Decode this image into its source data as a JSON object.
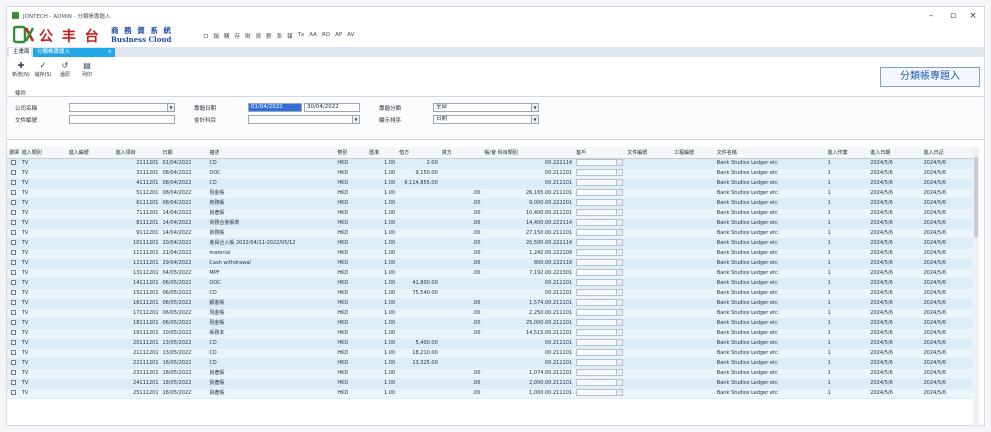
{
  "window": {
    "title": "JONTECH - ADMIN - 分類帳專題入",
    "controls": {
      "minimize": "–",
      "maximize": "▫",
      "close": "×"
    }
  },
  "brand": {
    "cn": "公 丰 台",
    "cn2": "商 務 資 系 統",
    "en": "Business Cloud"
  },
  "menu": [
    "ロ",
    "銷",
    "購",
    "存",
    "財",
    "資",
    "薪",
    "系",
    "報",
    "Tx",
    "AA",
    "RO",
    "AP",
    "AV"
  ],
  "tabs": [
    {
      "label": "主畫面"
    },
    {
      "label": "分類帳專題入",
      "close": "×"
    }
  ],
  "toolbar": {
    "buttons": [
      {
        "icon": "✚",
        "label": "新增(N)"
      },
      {
        "icon": "✓",
        "label": "儲存(S)"
      },
      {
        "icon": "↺",
        "label": "還原"
      },
      {
        "icon": "▤",
        "label": "列印"
      }
    ],
    "heading": "分類帳專題入",
    "condition_label": "條件"
  },
  "filters": {
    "company_code": {
      "label": "公司名稱",
      "value": ""
    },
    "doc_no": {
      "label": "文件編號",
      "value": ""
    },
    "date": {
      "label": "專題日期",
      "from": "01/04/2022",
      "to": "30/04/2022"
    },
    "account": {
      "label": "會計科目",
      "value": ""
    },
    "type": {
      "label": "專題分類",
      "value": "全部"
    },
    "sort": {
      "label": "顯示排序",
      "value": "日期"
    }
  },
  "table": {
    "columns": [
      "選擇",
      "進入類別",
      "進入編號",
      "進入項目",
      "日期",
      "描述",
      "幣別",
      "匯率",
      "借方",
      "貸方",
      "帳/會 科目類別",
      "客戶",
      "文件編號",
      "工程編號",
      "文件名稱",
      "進入作業",
      "進入日期",
      "進入日記"
    ],
    "rows": [
      [
        "TV",
        "",
        "2111201",
        "01/04/2022",
        "CD",
        "HKD",
        "1.00",
        "2.00",
        "",
        "00.222114",
        "",
        "",
        "",
        "Bank Studios Ledger etc",
        "1",
        "2024/5/6",
        "2024/5/6"
      ],
      [
        "TV",
        "",
        "3111201",
        "08/04/2022",
        "OOC",
        "HKD",
        "1.00",
        "9,150.00",
        "",
        "00.211101",
        "",
        "",
        "",
        "Bank Studios Ledger etc",
        "1",
        "2024/5/6",
        "2024/5/6"
      ],
      [
        "TV",
        "",
        "4111201",
        "08/04/2022",
        "CD",
        "HKD",
        "1.00",
        "6,114,855.00",
        "",
        "00.211101",
        "",
        "",
        "",
        "Bank Studios Ledger etc",
        "1",
        "2024/5/6",
        "2024/5/6"
      ],
      [
        "TV",
        "",
        "5111201",
        "08/04/2022",
        "現金帳",
        "HKD",
        "1.00",
        "",
        ".00",
        "26,165.00.211101",
        "",
        "",
        "",
        "Bank Studios Ledger etc",
        "1",
        "2024/5/6",
        "2024/5/6"
      ],
      [
        "TV",
        "",
        "6111201",
        "08/04/2022",
        "商務帳",
        "HKD",
        "1.00",
        "",
        ".00",
        "9,000.00.222201",
        "",
        "",
        "",
        "Bank Studios Ledger etc",
        "1",
        "2024/5/6",
        "2024/5/6"
      ],
      [
        "TV",
        "",
        "7111201",
        "14/04/2022",
        "資產帳",
        "HKD",
        "1.00",
        "",
        ".00",
        "10,400.00.211101",
        "",
        "",
        "",
        "Bank Studios Ledger etc",
        "1",
        "2024/5/6",
        "2024/5/6"
      ],
      [
        "TV",
        "",
        "8111201",
        "14/04/2022",
        "商務合會帳表",
        "HKD",
        "1.00",
        "",
        ".00",
        "14,400.00.222114",
        "",
        "",
        "",
        "Bank Studios Ledger etc",
        "1",
        "2024/5/6",
        "2024/5/6"
      ],
      [
        "TV",
        "",
        "9111201",
        "14/04/2022",
        "商務帳",
        "HKD",
        "1.00",
        "",
        ".00",
        "27,150.00.211101",
        "",
        "",
        "",
        "Bank Studios Ledger etc",
        "1",
        "2024/5/6",
        "2024/5/6"
      ],
      [
        "TV",
        "",
        "10111201",
        "20/04/2022",
        "會員合入帳 2022/04/11-2022/05/12",
        "HKD",
        "1.00",
        "",
        ".00",
        "20,500.00.222114",
        "",
        "",
        "",
        "Bank Studios Ledger etc",
        "1",
        "2024/5/6",
        "2024/5/6"
      ],
      [
        "TV",
        "",
        "11111201",
        "21/04/2022",
        "material",
        "HKD",
        "1.00",
        "",
        ".00",
        "1,242.00.222109",
        "",
        "",
        "",
        "Bank Studios Ledger etc",
        "1",
        "2024/5/6",
        "2024/5/6"
      ],
      [
        "TV",
        "",
        "12111201",
        "29/04/2022",
        "Cash withdrawal",
        "HKD",
        "1.00",
        "",
        ".00",
        "800.00.222118",
        "",
        "",
        "",
        "Bank Studios Ledger etc",
        "1",
        "2024/5/6",
        "2024/5/6"
      ],
      [
        "TV",
        "",
        "13111201",
        "04/05/2022",
        "MPF",
        "HKD",
        "1.00",
        "",
        ".00",
        "7,192.00.221301",
        "",
        "",
        "",
        "Bank Studios Ledger etc",
        "1",
        "2024/5/6",
        "2024/5/6"
      ],
      [
        "TV",
        "",
        "14111201",
        "06/05/2022",
        "OOC",
        "HKD",
        "1.00",
        "41,800.00",
        "",
        "00.211101",
        "",
        "",
        "",
        "Bank Studios Ledger etc",
        "1",
        "2024/5/6",
        "2024/5/6"
      ],
      [
        "TV",
        "",
        "15111201",
        "06/05/2022",
        "CD",
        "HKD",
        "1.00",
        "75,540.00",
        "",
        "00.211101",
        "",
        "",
        "",
        "Bank Studios Ledger etc",
        "1",
        "2024/5/6",
        "2024/5/6"
      ],
      [
        "TV",
        "",
        "16111201",
        "06/05/2022",
        "顧客帳",
        "HKD",
        "1.00",
        "",
        ".00",
        "1,574.00.211101",
        "",
        "",
        "",
        "Bank Studios Ledger etc",
        "1",
        "2024/5/6",
        "2024/5/6"
      ],
      [
        "TV",
        "",
        "17111201",
        "06/05/2022",
        "現金帳",
        "HKD",
        "1.00",
        "",
        ".00",
        "2,250.00.211101",
        "",
        "",
        "",
        "Bank Studios Ledger etc",
        "1",
        "2024/5/6",
        "2024/5/6"
      ],
      [
        "TV",
        "",
        "18111201",
        "06/05/2022",
        "現金帳",
        "HKD",
        "1.00",
        "",
        ".00",
        "25,000.00.211101",
        "",
        "",
        "",
        "Bank Studios Ledger etc",
        "1",
        "2024/5/6",
        "2024/5/6"
      ],
      [
        "TV",
        "",
        "19111201",
        "10/05/2022",
        "帳務本",
        "HKD",
        "1.00",
        "",
        ".00",
        "14,515.00.211101",
        "",
        "",
        "",
        "Bank Studios Ledger etc",
        "1",
        "2024/5/6",
        "2024/5/6"
      ],
      [
        "TV",
        "",
        "20111201",
        "13/05/2022",
        "CD",
        "HKD",
        "1.00",
        "5,400.00",
        "",
        "00.211101",
        "",
        "",
        "",
        "Bank Studios Ledger etc",
        "1",
        "2024/5/6",
        "2024/5/6"
      ],
      [
        "TV",
        "",
        "21111201",
        "13/05/2022",
        "CD",
        "HKD",
        "1.00",
        "18,210.00",
        "",
        "00.211101",
        "",
        "",
        "",
        "Bank Studios Ledger etc",
        "1",
        "2024/5/6",
        "2024/5/6"
      ],
      [
        "TV",
        "",
        "22111201",
        "16/05/2022",
        "CD",
        "HKD",
        "1.00",
        "13,325.00",
        "",
        "00.211101",
        "",
        "",
        "",
        "Bank Studios Ledger etc",
        "1",
        "2024/5/6",
        "2024/5/6"
      ],
      [
        "TV",
        "",
        "23111201",
        "18/05/2022",
        "資產帳",
        "HKD",
        "1.00",
        "",
        ".00",
        "1,074.00.211101",
        "",
        "",
        "",
        "Bank Studios Ledger etc",
        "1",
        "2024/5/6",
        "2024/5/6"
      ],
      [
        "TV",
        "",
        "24111201",
        "18/05/2022",
        "資產帳",
        "HKD",
        "1.00",
        "",
        ".00",
        "2,000.00.211101",
        "",
        "",
        "",
        "Bank Studios Ledger etc",
        "1",
        "2024/5/6",
        "2024/5/6"
      ],
      [
        "TV",
        "",
        "25111201",
        "18/05/2022",
        "資產帳",
        "HKD",
        "1.00",
        "",
        ".00",
        "1,000.00.211101",
        "",
        "",
        "",
        "Bank Studios Ledger etc",
        "1",
        "2024/5/6",
        "2024/5/6"
      ]
    ]
  }
}
